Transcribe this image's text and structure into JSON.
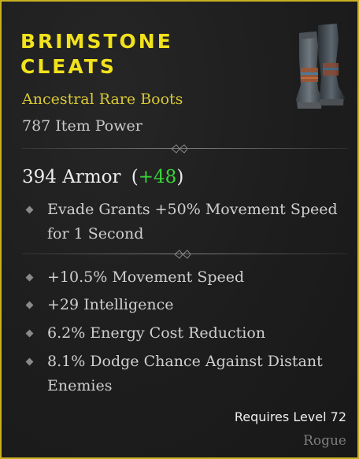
{
  "item": {
    "name": "Brimstone Cleats",
    "rarity_line": "Ancestral Rare Boots",
    "item_power": "787 Item Power",
    "armor": {
      "base": "394 Armor",
      "open": "(",
      "bonus": "+48",
      "close": ")"
    },
    "implicit": [
      "Evade Grants +50% Movement Speed",
      "for 1 Second"
    ],
    "affixes": [
      [
        "+10.5% Movement Speed"
      ],
      [
        "+29 Intelligence"
      ],
      [
        "6.2% Energy Cost Reduction"
      ],
      [
        "8.1% Dodge Chance Against Distant",
        "Enemies"
      ]
    ],
    "requires": "Requires Level 72",
    "class": "Rogue",
    "icon": "boots-icon"
  },
  "colors": {
    "title": "#f2e21c",
    "rarity": "#d8c836",
    "bonus": "#39d639",
    "border": "#c9b020"
  }
}
